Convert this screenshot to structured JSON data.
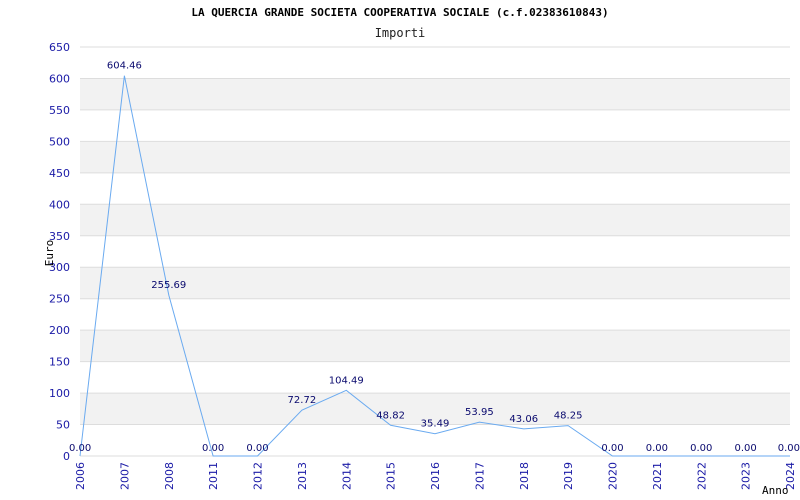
{
  "chart_data": {
    "type": "line",
    "title": "LA QUERCIA GRANDE SOCIETA COOPERATIVA SOCIALE (c.f.02383610843)",
    "subtitle": "Importi",
    "xlabel": "Anno",
    "ylabel": "Euro",
    "ylim": [
      0,
      650
    ],
    "yticks": [
      0,
      50,
      100,
      150,
      200,
      250,
      300,
      350,
      400,
      450,
      500,
      550,
      600,
      650
    ],
    "grid": true,
    "colors": {
      "line": "#6aaaf0",
      "band": "#f2f2f2",
      "tick": "#1a1aa6",
      "label": "#0a0a6e"
    },
    "x": [
      "2006",
      "2007",
      "2008",
      "2011",
      "2012",
      "2013",
      "2014",
      "2015",
      "2016",
      "2017",
      "2018",
      "2019",
      "2020",
      "2021",
      "2022",
      "2023",
      "2024"
    ],
    "values": [
      0.0,
      604.46,
      255.69,
      0.0,
      0.0,
      72.72,
      104.49,
      48.82,
      35.49,
      53.95,
      43.06,
      48.25,
      0.0,
      0.0,
      0.0,
      0.0,
      0.0
    ],
    "labels": [
      "0.00",
      "604.46",
      "255.69",
      "0.00",
      "0.00",
      "72.72",
      "104.49",
      "48.82",
      "35.49",
      "53.95",
      "43.06",
      "48.25",
      "0.00",
      "0.00",
      "0.00",
      "0.00",
      "0.00"
    ]
  }
}
